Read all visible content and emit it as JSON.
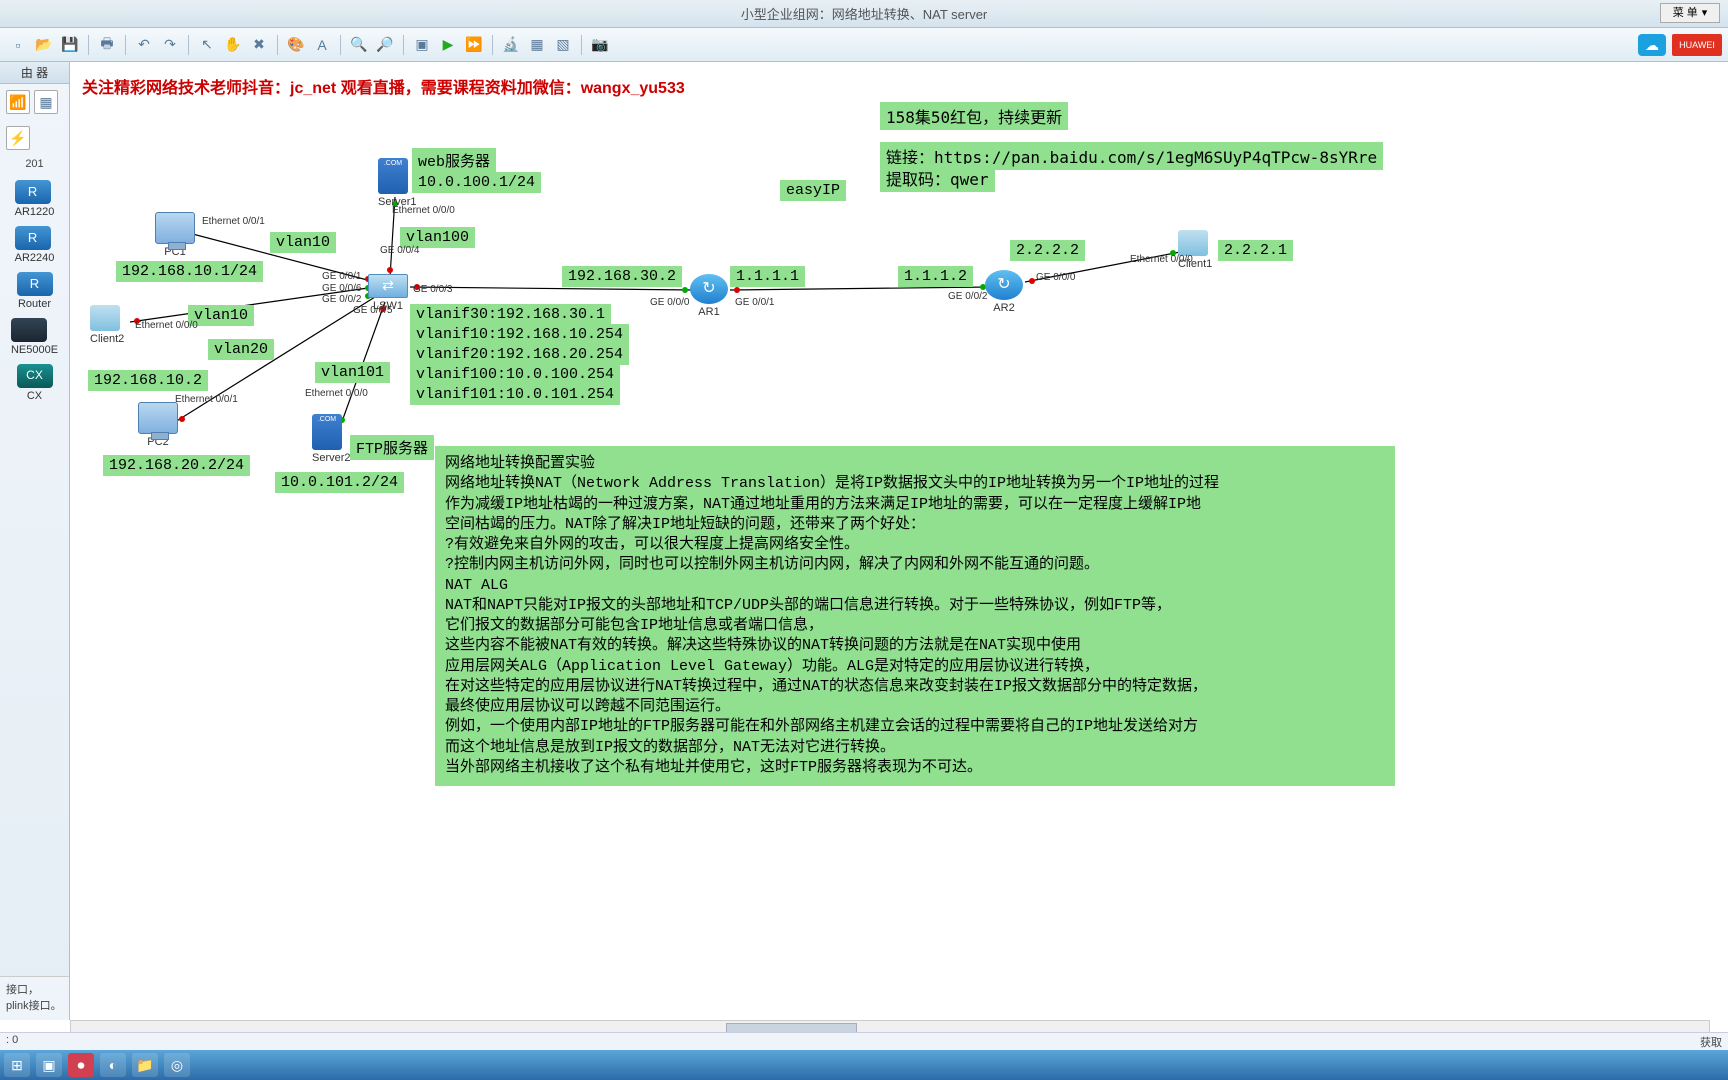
{
  "titlebar": {
    "title": "小型企业组网：网络地址转换、NAT server",
    "menu": "菜 单"
  },
  "toolbar_icons": [
    "new",
    "open",
    "save",
    "sep",
    "print",
    "sep",
    "undo",
    "redo",
    "sep",
    "pointer",
    "hand",
    "delete",
    "sep",
    "palette",
    "text",
    "sep",
    "zoom-in",
    "zoom-out",
    "sep",
    "chip",
    "play",
    "play-all",
    "sep",
    "inspect",
    "group",
    "ungroup",
    "sep",
    "camera"
  ],
  "palette": {
    "header": "由 器",
    "code": "201",
    "items": [
      {
        "label": "AR1220"
      },
      {
        "label": "AR2240"
      },
      {
        "label": "Router"
      },
      {
        "label": "NE5000E"
      },
      {
        "label": "CX"
      }
    ],
    "desc": "接口，\nplink接口。"
  },
  "banner": "关注精彩网络技术老师抖音：jc_net 观看直播，需要课程资料加微信：wangx_yu533",
  "infobox": {
    "line1": "158集50红包，持续更新",
    "line2": "链接：https://pan.baidu.com/s/1egM6SUyP4qTPcw-8sYRre",
    "line3": "提取码：qwer"
  },
  "labels": {
    "web_title": "web服务器",
    "web_ip": "10.0.100.1/24",
    "easyip": "easyIP",
    "vlan10a": "vlan10",
    "vlan10b": "vlan10",
    "vlan20": "vlan20",
    "vlan100": "vlan100",
    "vlan101": "vlan101",
    "pc1_ip": "192.168.10.1/24",
    "client2_ip": "192.168.10.2",
    "pc2_ip": "192.168.20.2/24",
    "lsw_gw": "192.168.30.2",
    "ar1_l": "1.1.1.1",
    "ar1_r": "1.1.1.2",
    "ar2_r": "2.2.2.2",
    "client1_ip": "2.2.2.1",
    "ftp_title": "FTP服务器",
    "ftp_ip": "10.0.101.2/24",
    "vlanif30": "vlanif30:192.168.30.1",
    "vlanif10": "vlanif10:192.168.10.254",
    "vlanif20": "vlanif20:192.168.20.254",
    "vlanif100": "vlanif100:10.0.100.254",
    "vlanif101": "vlanif101:10.0.101.254"
  },
  "ports": {
    "server1_e": "Ethernet 0/0/0",
    "pc1_e": "Ethernet 0/0/1",
    "client2_e": "Ethernet 0/0/0",
    "pc2_e": "Ethernet 0/0/1",
    "server2_e": "Ethernet 0/0/0",
    "lsw_g1": "GE 0/0/1",
    "lsw_g2": "GE 0/0/2",
    "lsw_g3": "GE 0/0/3",
    "lsw_g4": "GE 0/0/4",
    "lsw_g5": "GE 0/0/5",
    "lsw_g6": "GE 0/0/6",
    "ar1_g0": "GE 0/0/0",
    "ar1_g1": "GE 0/0/1",
    "ar2_g0": "GE 0/0/0",
    "ar2_g2": "GE 0/0/2",
    "client1_e": "Ethernet 0/0/0"
  },
  "devices": {
    "pc1": "PC1",
    "pc2": "PC2",
    "client1": "Client1",
    "client2": "Client2",
    "server1": "Server1",
    "server2": "Server2",
    "lsw1": "LSW1",
    "ar1": "AR1",
    "ar2": "AR2"
  },
  "essay": {
    "title": "网络地址转换配置实验",
    "p1": "    网络地址转换NAT（Network Address Translation）是将IP数据报文头中的IP地址转换为另一个IP地址的过程",
    "p2": "作为减缓IP地址枯竭的一种过渡方案，NAT通过地址重用的方法来满足IP地址的需要，可以在一定程度上缓解IP地",
    "p3": "空间枯竭的压力。NAT除了解决IP地址短缺的问题，还带来了两个好处：",
    "p4": "  ?有效避免来自外网的攻击，可以很大程度上提高网络安全性。",
    "p5": "  ?控制内网主机访问外网，同时也可以控制外网主机访问内网，解决了内网和外网不能互通的问题。",
    "p6": "NAT ALG",
    "p7": "NAT和NAPT只能对IP报文的头部地址和TCP/UDP头部的端口信息进行转换。对于一些特殊协议，例如FTP等，",
    "p8": "它们报文的数据部分可能包含IP地址信息或者端口信息，",
    "p9": "这些内容不能被NAT有效的转换。解决这些特殊协议的NAT转换问题的方法就是在NAT实现中使用",
    "p10": "应用层网关ALG（Application Level Gateway）功能。ALG是对特定的应用层协议进行转换，",
    "p11": "在对这些特定的应用层协议进行NAT转换过程中，通过NAT的状态信息来改变封装在IP报文数据部分中的特定数据，",
    "p12": "最终使应用层协议可以跨越不同范围运行。",
    "p13": "",
    "p14": "例如，一个使用内部IP地址的FTP服务器可能在和外部网络主机建立会话的过程中需要将自己的IP地址发送给对方",
    "p15": "而这个地址信息是放到IP报文的数据部分，NAT无法对它进行转换。",
    "p16": "当外部网络主机接收了这个私有地址并使用它，这时FTP服务器将表现为不可达。"
  },
  "status": {
    "left": ": 0",
    "right": "获取"
  }
}
